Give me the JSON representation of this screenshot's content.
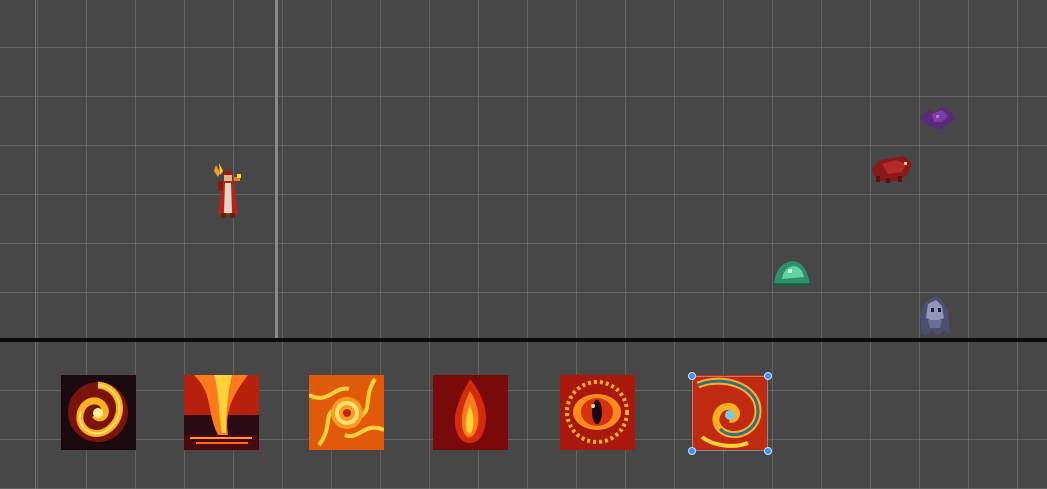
{
  "scene": {
    "colors": {
      "background": "#474747",
      "grid": "#6e6e6e",
      "ground": "#0a0a0a",
      "selection": "#3d8dff"
    }
  },
  "characters": [
    {
      "name": "fire-mage-sprite",
      "kind": "player"
    },
    {
      "name": "purple-bat-sprite",
      "kind": "enemy"
    },
    {
      "name": "red-beast-sprite",
      "kind": "enemy"
    },
    {
      "name": "green-slime-sprite",
      "kind": "enemy"
    },
    {
      "name": "grey-ghost-sprite",
      "kind": "enemy"
    }
  ],
  "skills": [
    {
      "icon": "fire-swirl-icon"
    },
    {
      "icon": "lava-fall-icon"
    },
    {
      "icon": "fire-spiral-icon"
    },
    {
      "icon": "flame-icon"
    },
    {
      "icon": "fire-eye-icon"
    },
    {
      "icon": "vortex-icon",
      "selected": true
    }
  ]
}
